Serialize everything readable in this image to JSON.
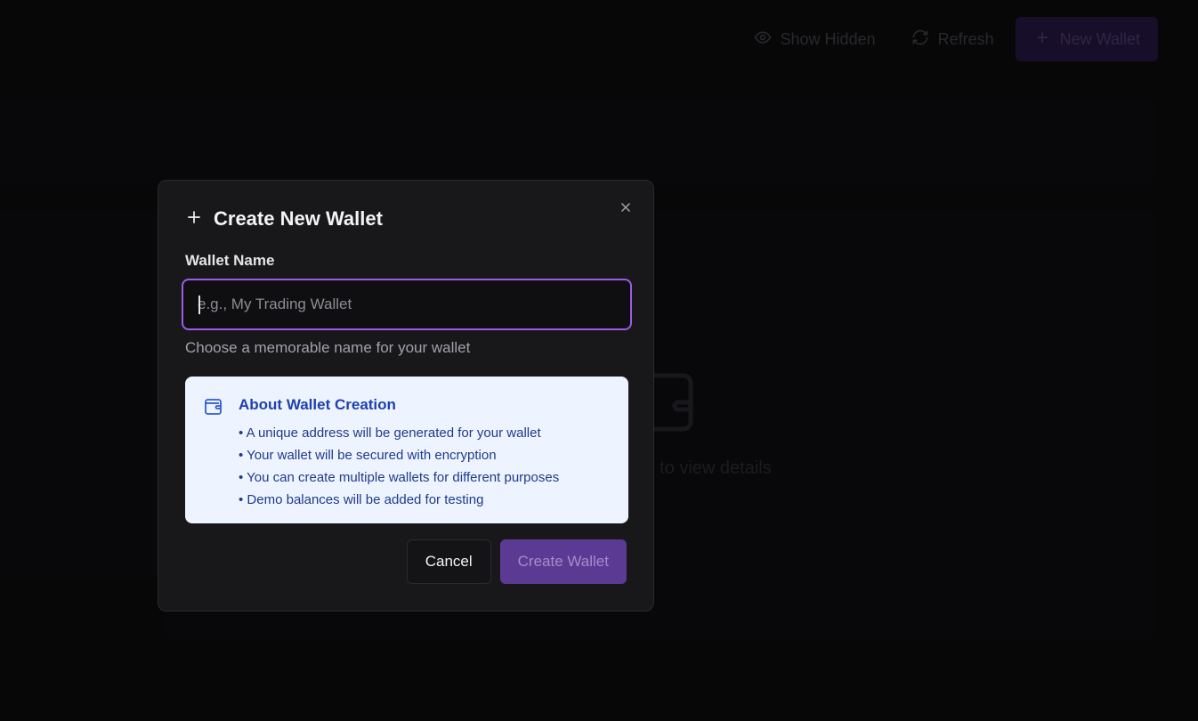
{
  "topbar": {
    "show_hidden_label": "Show Hidden",
    "refresh_label": "Refresh",
    "new_wallet_label": "New Wallet"
  },
  "background": {
    "hint_text": "t to view details"
  },
  "modal": {
    "title": "Create New Wallet",
    "field_label": "Wallet Name",
    "input_value": "",
    "input_placeholder": "e.g., My Trading Wallet",
    "helper_text": "Choose a memorable name for your wallet",
    "info": {
      "title": "About Wallet Creation",
      "items": [
        "A unique address will be generated for your wallet",
        "Your wallet will be secured with encryption",
        "You can create multiple wallets for different purposes",
        "Demo balances will be added for testing"
      ]
    },
    "cancel_label": "Cancel",
    "create_label": "Create Wallet"
  },
  "colors": {
    "accent": "#9b5de5",
    "primary_button": "#5b3a94",
    "info_bg": "#eef4ff",
    "info_text": "#1e40af"
  }
}
